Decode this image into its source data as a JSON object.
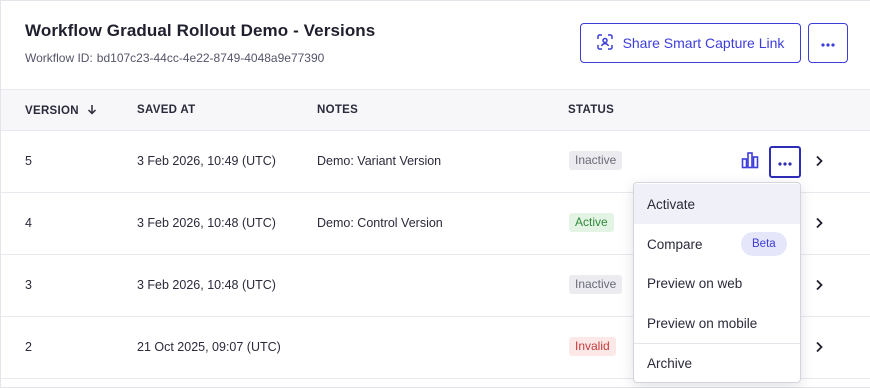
{
  "header": {
    "title": "Workflow Gradual Rollout Demo - Versions",
    "workflow_id_label": "Workflow ID:",
    "workflow_id": "bd107c23-44cc-4e22-8749-4048a9e77390",
    "share_button_label": "Share Smart Capture Link"
  },
  "table": {
    "columns": {
      "version": "VERSION",
      "saved_at": "SAVED AT",
      "notes": "NOTES",
      "status": "STATUS"
    },
    "rows": [
      {
        "version": "5",
        "saved_at": "3 Feb 2026, 10:49 (UTC)",
        "notes": "Demo: Variant Version",
        "status": "Inactive"
      },
      {
        "version": "4",
        "saved_at": "3 Feb 2026, 10:48 (UTC)",
        "notes": "Demo: Control Version",
        "status": "Active"
      },
      {
        "version": "3",
        "saved_at": "3 Feb 2026, 10:48 (UTC)",
        "notes": "",
        "status": "Inactive"
      },
      {
        "version": "2",
        "saved_at": "21 Oct 2025, 09:07 (UTC)",
        "notes": "",
        "status": "Invalid"
      }
    ]
  },
  "menu": {
    "items": [
      {
        "label": "Activate"
      },
      {
        "label": "Compare",
        "badge": "Beta"
      },
      {
        "label": "Preview on web"
      },
      {
        "label": "Preview on mobile"
      },
      {
        "label": "Archive"
      }
    ]
  },
  "colors": {
    "accent": "#3d3ddb",
    "status_active": "#2e8a3a",
    "status_invalid": "#c43a3a",
    "status_inactive": "#6a6a78"
  },
  "icons": {
    "share": "qr-scan-icon",
    "more": "more-horizontal-icon",
    "sort": "arrow-down-icon",
    "analytics": "bar-chart-icon",
    "row_open": "chevron-right-icon"
  }
}
